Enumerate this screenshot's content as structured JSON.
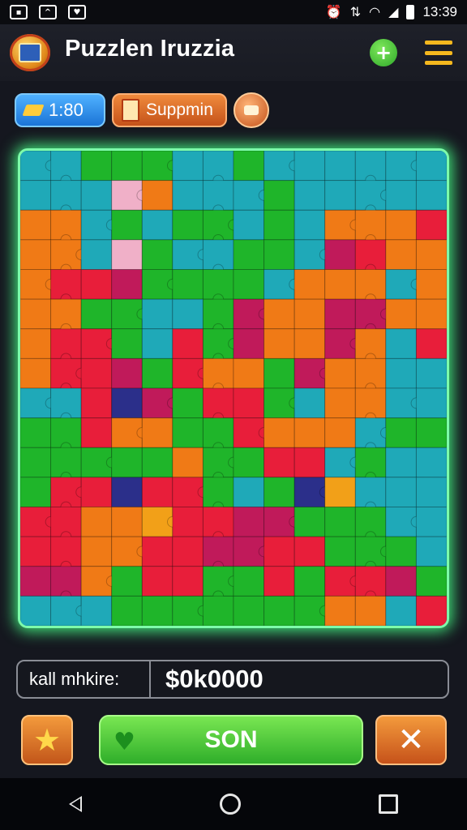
{
  "status_bar": {
    "time": "13:39",
    "left_icons": [
      "photo-icon",
      "mountain-icon",
      "shield-icon"
    ],
    "right_icons": [
      "alarm-icon",
      "signal-icon",
      "wifi-icon",
      "cell-signal-icon",
      "battery-icon"
    ]
  },
  "header": {
    "title": "Puzzlen Iruzzia",
    "logo_icon": "treasure-chest-icon",
    "add_icon": "plus-icon",
    "menu_icon": "hamburger-menu-icon"
  },
  "toolbar": {
    "timer_value": "1:80",
    "support_label": "Suppmin",
    "gift_icon": "gift-icon"
  },
  "puzzle": {
    "columns": 14,
    "rows": 16,
    "palette": {
      "g": "#1fb52a",
      "t": "#1fa9b8",
      "o": "#f07a16",
      "r": "#e81e3a",
      "m": "#c01a5a",
      "p": "#f0b0c8",
      "n": "#2b2f8a",
      "y": "#f2a018"
    },
    "grid": [
      "ttgggttgtttttt",
      "tttpotttgttttt",
      "ootgtggtgtooor",
      "ootpgttggtmroo",
      "orrmggggtoooto",
      "ooggttgmoommoo",
      "orrgtrgmoomotr",
      "orrmgroogmoott",
      "ttrnmgrrgtoott",
      "ggrooggroootgg",
      "gggggoggrrtgtt",
      "grrnrrgtgnytt t",
      "rrooyrrmmgggtt",
      "rroorrmmrrgggt",
      "mmogrrggrgrrmg",
      "tttgggggggootr"
    ]
  },
  "price_bar": {
    "label": "kall mhkire:",
    "value": "$0k0000"
  },
  "actions": {
    "star_icon": "star-icon",
    "confirm_label": "SON",
    "confirm_icon": "heart-icon",
    "close_icon": "close-icon"
  },
  "nav_bar": {
    "icons": [
      "back-icon",
      "home-icon",
      "recents-icon"
    ]
  }
}
